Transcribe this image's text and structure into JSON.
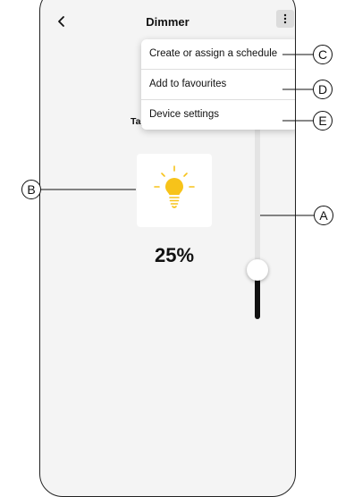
{
  "header": {
    "title": "Dimmer"
  },
  "menu": {
    "items": [
      "Create or assign a schedule",
      "Add to favourites",
      "Device settings"
    ]
  },
  "content": {
    "hidden_label": "Tap",
    "brightness_level": 25,
    "brightness_text": "25%"
  },
  "callouts": {
    "a": "A",
    "b": "B",
    "c": "C",
    "d": "D",
    "e": "E"
  },
  "colors": {
    "bulb": "#f7c31a",
    "slider_fill": "#111111",
    "slider_track": "#e4e4e4"
  },
  "icons": {
    "back": "chevron-left-icon",
    "more": "more-vertical-icon",
    "bulb": "light-bulb-icon"
  }
}
